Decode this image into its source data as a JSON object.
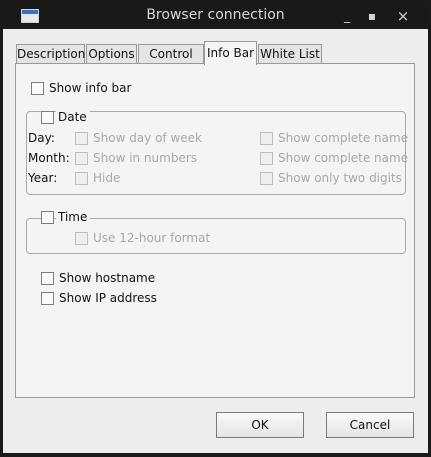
{
  "window": {
    "title": "Browser connection",
    "buttons": {
      "minimize": "_",
      "maximize": "▪",
      "close": "×"
    }
  },
  "tabs": [
    {
      "label": "Description"
    },
    {
      "label": "Options"
    },
    {
      "label": "Control Bar"
    },
    {
      "label": "Info Bar",
      "active": true
    },
    {
      "label": "White List"
    }
  ],
  "info_bar": {
    "show_info_bar": "Show info bar",
    "date": {
      "label": "Date",
      "rows": [
        {
          "row_label": "Day:",
          "left": "Show day of week",
          "right": "Show complete name"
        },
        {
          "row_label": "Month:",
          "left": "Show in numbers",
          "right": "Show complete name"
        },
        {
          "row_label": "Year:",
          "left": "Hide",
          "right": "Show only two digits"
        }
      ]
    },
    "time": {
      "label": "Time",
      "option": "Use 12-hour format"
    },
    "show_hostname": "Show hostname",
    "show_ip": "Show IP address"
  },
  "footer": {
    "ok": "OK",
    "cancel": "Cancel"
  },
  "colors": {
    "titlebar": "#191919",
    "dialog": "#ededed",
    "icon_accent": "#3c6fc6"
  }
}
